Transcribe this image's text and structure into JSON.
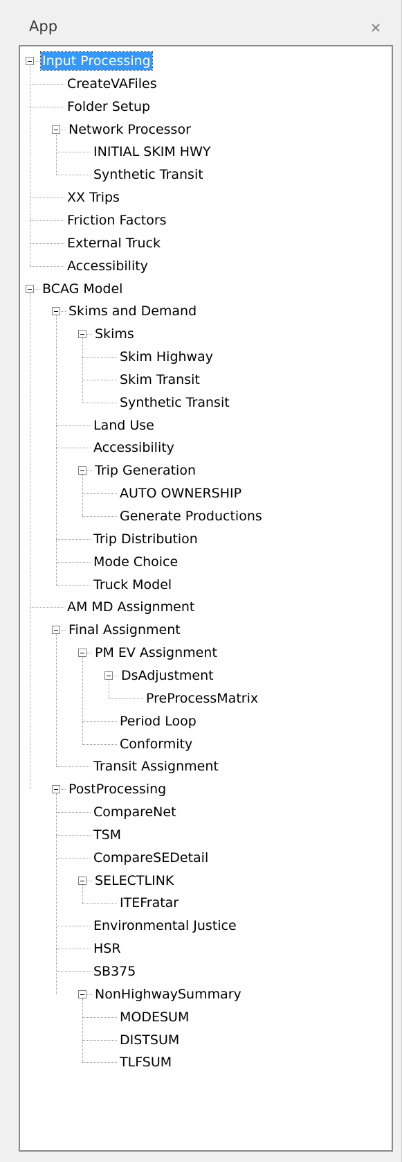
{
  "panel": {
    "title": "App"
  },
  "tree": {
    "nodes": [
      {
        "label": "Input Processing",
        "level": 0,
        "expanded": true,
        "selected": true
      },
      {
        "label": "CreateVAFiles",
        "level": 1
      },
      {
        "label": "Folder Setup",
        "level": 1
      },
      {
        "label": "Network Processor",
        "level": 1,
        "expanded": true
      },
      {
        "label": "INITIAL SKIM HWY",
        "level": 2
      },
      {
        "label": "Synthetic Transit",
        "level": 2
      },
      {
        "label": "XX Trips",
        "level": 1
      },
      {
        "label": "Friction Factors",
        "level": 1
      },
      {
        "label": "External Truck",
        "level": 1
      },
      {
        "label": "Accessibility",
        "level": 1
      },
      {
        "label": "BCAG Model",
        "level": 0,
        "expanded": true
      },
      {
        "label": "Skims and Demand",
        "level": 1,
        "expanded": true
      },
      {
        "label": "Skims",
        "level": 2,
        "expanded": true
      },
      {
        "label": "Skim Highway",
        "level": 3
      },
      {
        "label": "Skim Transit",
        "level": 3
      },
      {
        "label": "Synthetic Transit",
        "level": 3
      },
      {
        "label": "Land Use",
        "level": 2
      },
      {
        "label": "Accessibility",
        "level": 2
      },
      {
        "label": "Trip Generation",
        "level": 2,
        "expanded": true
      },
      {
        "label": "AUTO OWNERSHIP",
        "level": 3
      },
      {
        "label": "Generate Productions",
        "level": 3
      },
      {
        "label": "Trip Distribution",
        "level": 2
      },
      {
        "label": "Mode Choice",
        "level": 2
      },
      {
        "label": "Truck Model",
        "level": 2
      },
      {
        "label": "AM MD Assignment",
        "level": 1
      },
      {
        "label": "Final Assignment",
        "level": 1,
        "expanded": true
      },
      {
        "label": "PM EV Assignment",
        "level": 2,
        "expanded": true
      },
      {
        "label": "DsAdjustment",
        "level": 3,
        "expanded": true
      },
      {
        "label": "PreProcessMatrix",
        "level": 4
      },
      {
        "label": "Period Loop",
        "level": 3
      },
      {
        "label": "Conformity",
        "level": 3
      },
      {
        "label": "Transit Assignment",
        "level": 2
      },
      {
        "label": "PostProcessing",
        "level": 1,
        "expanded": true
      },
      {
        "label": "CompareNet",
        "level": 2
      },
      {
        "label": "TSM",
        "level": 2
      },
      {
        "label": "CompareSEDetail",
        "level": 2
      },
      {
        "label": "SELECTLINK",
        "level": 2,
        "expanded": true
      },
      {
        "label": "ITEFratar",
        "level": 3
      },
      {
        "label": "Environmental Justice",
        "level": 2
      },
      {
        "label": "HSR",
        "level": 2
      },
      {
        "label": "SB375",
        "level": 2
      },
      {
        "label": "NonHighwaySummary",
        "level": 2,
        "expanded": true
      },
      {
        "label": "MODESUM",
        "level": 3
      },
      {
        "label": "DISTSUM",
        "level": 3
      },
      {
        "label": "TLFSUM",
        "level": 3
      }
    ]
  },
  "icons": {
    "close": "close-icon",
    "collapse": "collapse-minus-icon"
  },
  "colors": {
    "selection": "#3399ff",
    "border": "#8a8a8a",
    "panel": "#f0f0f0"
  }
}
